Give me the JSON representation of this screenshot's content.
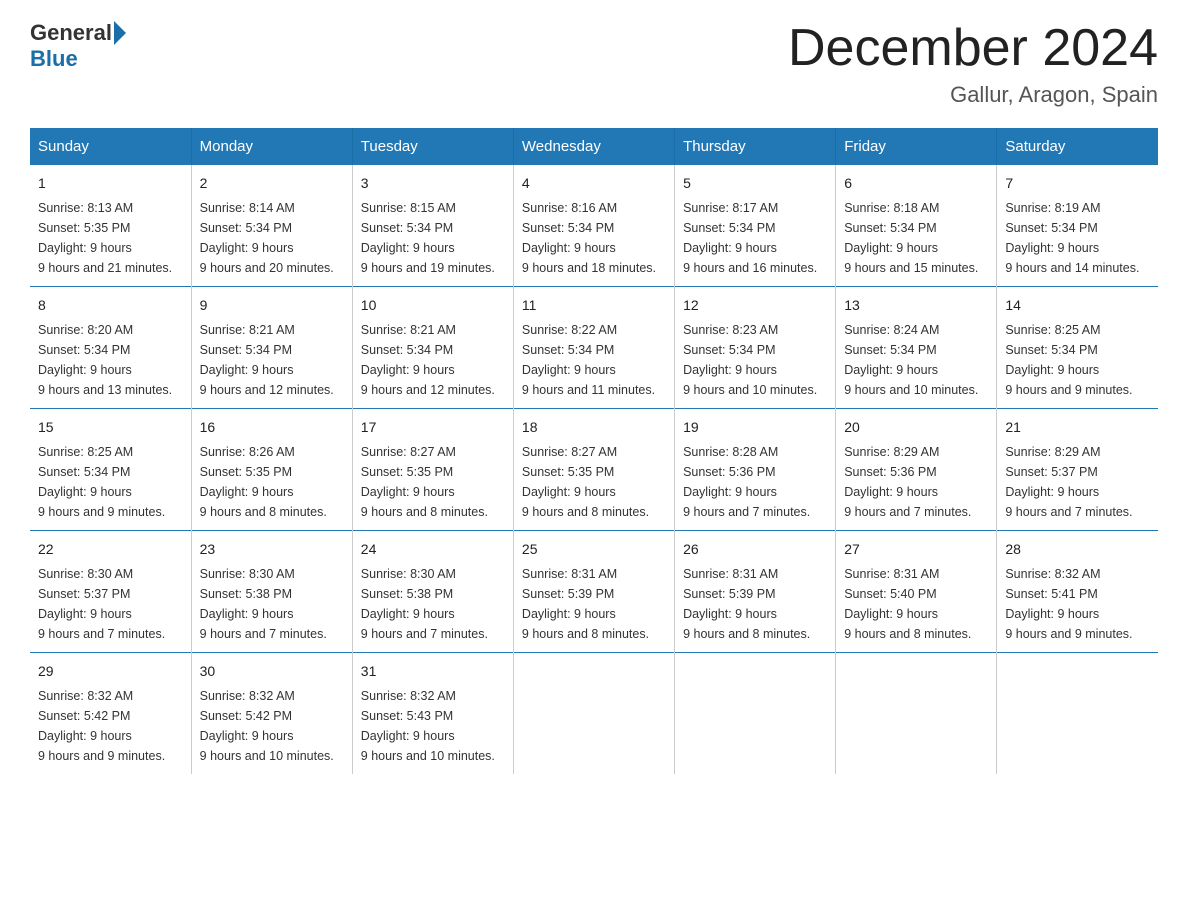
{
  "header": {
    "logo_general": "General",
    "logo_blue": "Blue",
    "main_title": "December 2024",
    "subtitle": "Gallur, Aragon, Spain"
  },
  "days_of_week": [
    "Sunday",
    "Monday",
    "Tuesday",
    "Wednesday",
    "Thursday",
    "Friday",
    "Saturday"
  ],
  "weeks": [
    [
      {
        "num": "1",
        "sunrise": "8:13 AM",
        "sunset": "5:35 PM",
        "daylight": "9 hours and 21 minutes."
      },
      {
        "num": "2",
        "sunrise": "8:14 AM",
        "sunset": "5:34 PM",
        "daylight": "9 hours and 20 minutes."
      },
      {
        "num": "3",
        "sunrise": "8:15 AM",
        "sunset": "5:34 PM",
        "daylight": "9 hours and 19 minutes."
      },
      {
        "num": "4",
        "sunrise": "8:16 AM",
        "sunset": "5:34 PM",
        "daylight": "9 hours and 18 minutes."
      },
      {
        "num": "5",
        "sunrise": "8:17 AM",
        "sunset": "5:34 PM",
        "daylight": "9 hours and 16 minutes."
      },
      {
        "num": "6",
        "sunrise": "8:18 AM",
        "sunset": "5:34 PM",
        "daylight": "9 hours and 15 minutes."
      },
      {
        "num": "7",
        "sunrise": "8:19 AM",
        "sunset": "5:34 PM",
        "daylight": "9 hours and 14 minutes."
      }
    ],
    [
      {
        "num": "8",
        "sunrise": "8:20 AM",
        "sunset": "5:34 PM",
        "daylight": "9 hours and 13 minutes."
      },
      {
        "num": "9",
        "sunrise": "8:21 AM",
        "sunset": "5:34 PM",
        "daylight": "9 hours and 12 minutes."
      },
      {
        "num": "10",
        "sunrise": "8:21 AM",
        "sunset": "5:34 PM",
        "daylight": "9 hours and 12 minutes."
      },
      {
        "num": "11",
        "sunrise": "8:22 AM",
        "sunset": "5:34 PM",
        "daylight": "9 hours and 11 minutes."
      },
      {
        "num": "12",
        "sunrise": "8:23 AM",
        "sunset": "5:34 PM",
        "daylight": "9 hours and 10 minutes."
      },
      {
        "num": "13",
        "sunrise": "8:24 AM",
        "sunset": "5:34 PM",
        "daylight": "9 hours and 10 minutes."
      },
      {
        "num": "14",
        "sunrise": "8:25 AM",
        "sunset": "5:34 PM",
        "daylight": "9 hours and 9 minutes."
      }
    ],
    [
      {
        "num": "15",
        "sunrise": "8:25 AM",
        "sunset": "5:34 PM",
        "daylight": "9 hours and 9 minutes."
      },
      {
        "num": "16",
        "sunrise": "8:26 AM",
        "sunset": "5:35 PM",
        "daylight": "9 hours and 8 minutes."
      },
      {
        "num": "17",
        "sunrise": "8:27 AM",
        "sunset": "5:35 PM",
        "daylight": "9 hours and 8 minutes."
      },
      {
        "num": "18",
        "sunrise": "8:27 AM",
        "sunset": "5:35 PM",
        "daylight": "9 hours and 8 minutes."
      },
      {
        "num": "19",
        "sunrise": "8:28 AM",
        "sunset": "5:36 PM",
        "daylight": "9 hours and 7 minutes."
      },
      {
        "num": "20",
        "sunrise": "8:29 AM",
        "sunset": "5:36 PM",
        "daylight": "9 hours and 7 minutes."
      },
      {
        "num": "21",
        "sunrise": "8:29 AM",
        "sunset": "5:37 PM",
        "daylight": "9 hours and 7 minutes."
      }
    ],
    [
      {
        "num": "22",
        "sunrise": "8:30 AM",
        "sunset": "5:37 PM",
        "daylight": "9 hours and 7 minutes."
      },
      {
        "num": "23",
        "sunrise": "8:30 AM",
        "sunset": "5:38 PM",
        "daylight": "9 hours and 7 minutes."
      },
      {
        "num": "24",
        "sunrise": "8:30 AM",
        "sunset": "5:38 PM",
        "daylight": "9 hours and 7 minutes."
      },
      {
        "num": "25",
        "sunrise": "8:31 AM",
        "sunset": "5:39 PM",
        "daylight": "9 hours and 8 minutes."
      },
      {
        "num": "26",
        "sunrise": "8:31 AM",
        "sunset": "5:39 PM",
        "daylight": "9 hours and 8 minutes."
      },
      {
        "num": "27",
        "sunrise": "8:31 AM",
        "sunset": "5:40 PM",
        "daylight": "9 hours and 8 minutes."
      },
      {
        "num": "28",
        "sunrise": "8:32 AM",
        "sunset": "5:41 PM",
        "daylight": "9 hours and 9 minutes."
      }
    ],
    [
      {
        "num": "29",
        "sunrise": "8:32 AM",
        "sunset": "5:42 PM",
        "daylight": "9 hours and 9 minutes."
      },
      {
        "num": "30",
        "sunrise": "8:32 AM",
        "sunset": "5:42 PM",
        "daylight": "9 hours and 10 minutes."
      },
      {
        "num": "31",
        "sunrise": "8:32 AM",
        "sunset": "5:43 PM",
        "daylight": "9 hours and 10 minutes."
      },
      null,
      null,
      null,
      null
    ]
  ]
}
